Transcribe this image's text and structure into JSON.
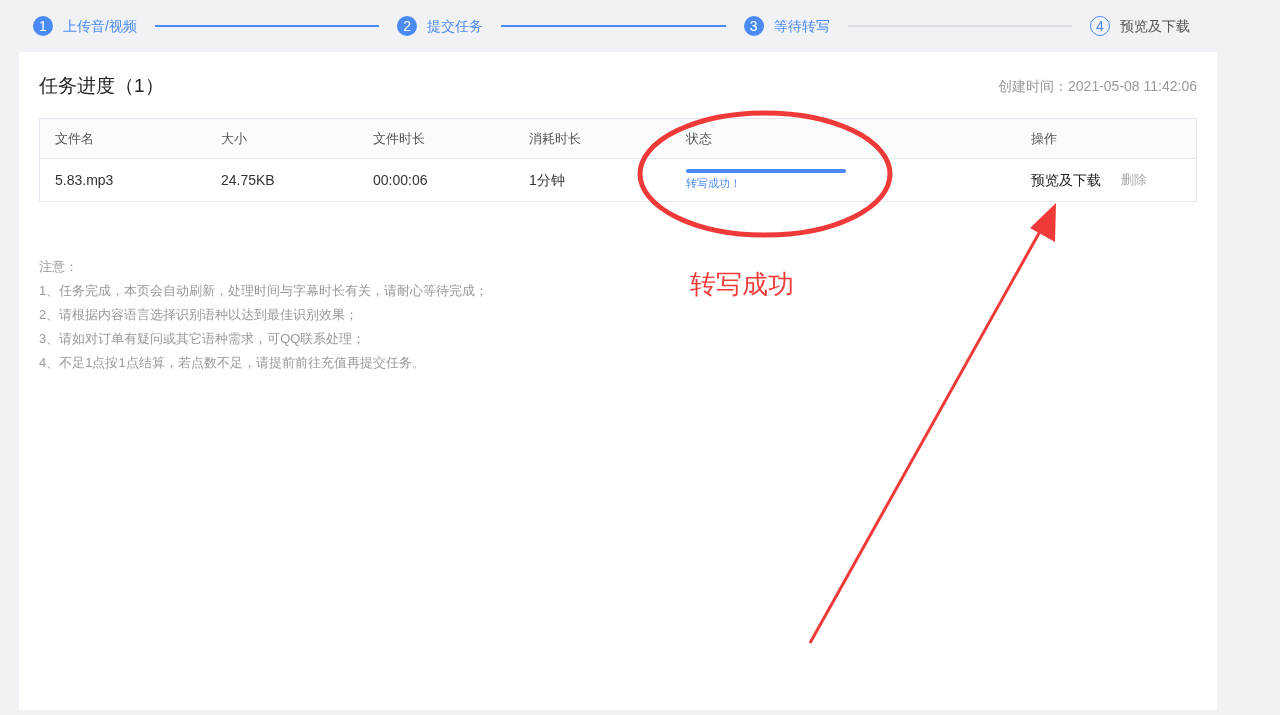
{
  "steps": [
    {
      "number": "1",
      "label": "上传音/视频",
      "done": true
    },
    {
      "number": "2",
      "label": "提交任务",
      "done": true
    },
    {
      "number": "3",
      "label": "等待转写",
      "done": true
    },
    {
      "number": "4",
      "label": "预览及下载",
      "done": false
    }
  ],
  "task": {
    "title": "任务进度（1）",
    "created": "创建时间：2021-05-08 11:42:06"
  },
  "table": {
    "columns": [
      "文件名",
      "大小",
      "文件时长",
      "消耗时长",
      "状态",
      "操作"
    ],
    "rows": [
      {
        "file": "5.83.mp3",
        "size": "24.75KB",
        "duration": "00:00:06",
        "cost": "1分钟",
        "status": {
          "level": 1,
          "text": "转写成功！"
        },
        "actions": [
          "预览及下载",
          "删除"
        ]
      }
    ]
  },
  "notes": [
    "注意：",
    "1、任务完成，本页会自动刷新，处理时间与字幕时长有关，请耐心等待完成；",
    "2、请根据内容语言选择识别语种以达到最佳识别效果；",
    "3、请如对订单有疑问或其它语种需求，可QQ联系处理；",
    "4、不足1点按1点结算，若点数不足，请提前前往充值再提交任务。"
  ],
  "annotation": {
    "label": "转写成功"
  }
}
